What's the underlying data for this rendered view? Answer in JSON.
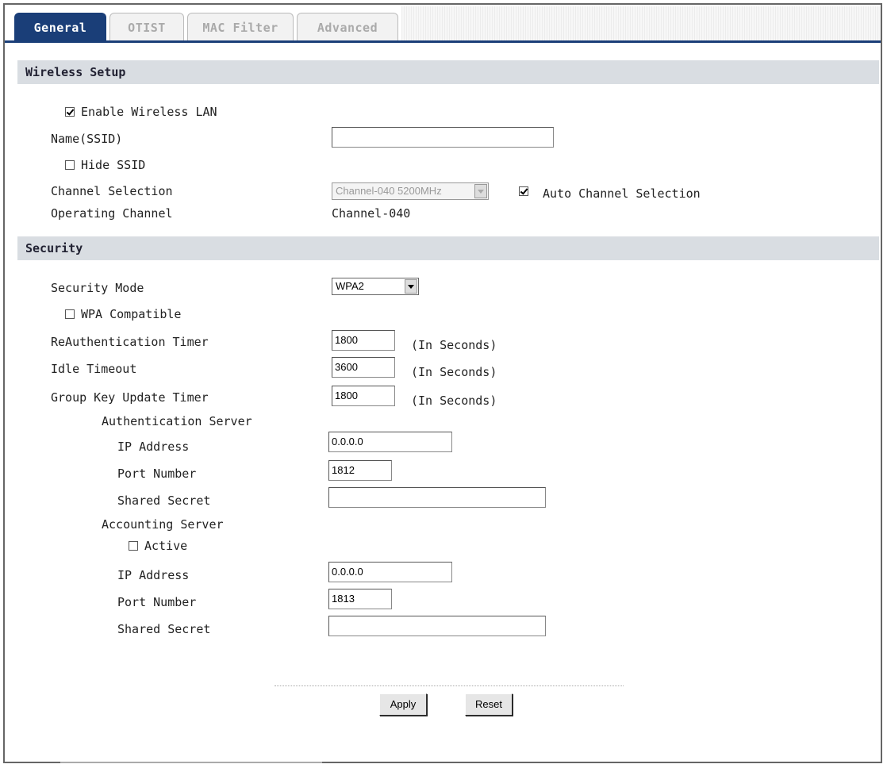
{
  "tabs": [
    "General",
    "OTIST",
    "MAC Filter",
    "Advanced"
  ],
  "wireless": {
    "heading": "Wireless Setup",
    "enable_label": "Enable Wireless LAN",
    "enable_checked": true,
    "ssid_label": "Name(SSID)",
    "ssid_value": "",
    "hide_label": "Hide SSID",
    "hide_checked": false,
    "channel_label": "Channel Selection",
    "channel_value": "Channel-040 5200MHz",
    "auto_channel_label": "Auto Channel Selection",
    "auto_channel_checked": true,
    "operating_label": "Operating Channel",
    "operating_value": "Channel-040"
  },
  "security": {
    "heading": "Security",
    "mode_label": "Security Mode",
    "mode_value": "WPA2",
    "wpa_compat_label": "WPA Compatible",
    "wpa_compat_checked": false,
    "reauth_label": "ReAuthentication Timer",
    "reauth_value": "1800",
    "idle_label": "Idle Timeout",
    "idle_value": "3600",
    "group_key_label": "Group Key Update Timer",
    "group_key_value": "1800",
    "seconds_unit": "(In Seconds)",
    "auth_server": {
      "heading": "Authentication Server",
      "ip_label": "IP Address",
      "ip_value": "0.0.0.0",
      "port_label": "Port Number",
      "port_value": "1812",
      "secret_label": "Shared Secret",
      "secret_value": ""
    },
    "acct_server": {
      "heading": "Accounting Server",
      "active_label": "Active",
      "active_checked": false,
      "ip_label": "IP Address",
      "ip_value": "0.0.0.0",
      "port_label": "Port Number",
      "port_value": "1813",
      "secret_label": "Shared Secret",
      "secret_value": ""
    }
  },
  "buttons": {
    "apply": "Apply",
    "reset": "Reset"
  }
}
